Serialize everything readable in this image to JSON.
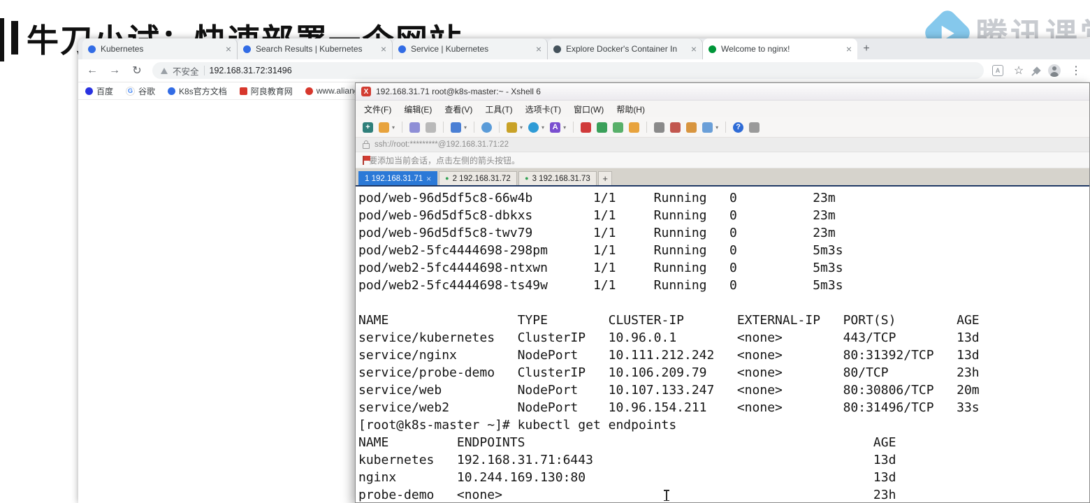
{
  "video": {
    "title": "牛刀小试：快速部署一个网站",
    "brand": "腾讯课堂"
  },
  "browser": {
    "tabs": [
      {
        "label": "Kubernetes"
      },
      {
        "label": "Search Results | Kubernetes"
      },
      {
        "label": "Service | Kubernetes"
      },
      {
        "label": "Explore Docker's Container In"
      },
      {
        "label": "Welcome to nginx!"
      }
    ],
    "address": {
      "security_label": "不安全",
      "url": "192.168.31.72:31496"
    },
    "bookmarks": [
      {
        "label": "百度"
      },
      {
        "label": "谷歌"
      },
      {
        "label": "K8s官方文档"
      },
      {
        "label": "阿良教育网"
      },
      {
        "label": "www.aliangedu..."
      }
    ]
  },
  "xshell": {
    "window_title": "192.168.31.71 root@k8s-master:~ - Xshell 6",
    "menu_items": [
      "文件(F)",
      "编辑(E)",
      "查看(V)",
      "工具(T)",
      "选项卡(T)",
      "窗口(W)",
      "帮助(H)"
    ],
    "ssh_bar": "ssh://root:*********@192.168.31.71:22",
    "hint_bar": "要添加当前会话，点击左侧的箭头按钮。",
    "session_tabs": [
      {
        "label": "1 192.168.31.71",
        "active": true
      },
      {
        "label": "2 192.168.31.72",
        "active": false
      },
      {
        "label": "3 192.168.31.73",
        "active": false
      }
    ],
    "terminal": {
      "lines": [
        "pod/web-96d5df5c8-66w4b        1/1     Running   0          23m",
        "pod/web-96d5df5c8-dbkxs        1/1     Running   0          23m",
        "pod/web-96d5df5c8-twv79        1/1     Running   0          23m",
        "pod/web2-5fc4444698-298pm      1/1     Running   0          5m3s",
        "pod/web2-5fc4444698-ntxwn      1/1     Running   0          5m3s",
        "pod/web2-5fc4444698-ts49w      1/1     Running   0          5m3s",
        "",
        "NAME                 TYPE        CLUSTER-IP       EXTERNAL-IP   PORT(S)        AGE",
        "service/kubernetes   ClusterIP   10.96.0.1        <none>        443/TCP        13d",
        "service/nginx        NodePort    10.111.212.242   <none>        80:31392/TCP   13d",
        "service/probe-demo   ClusterIP   10.106.209.79    <none>        80/TCP         23h",
        "service/web          NodePort    10.107.133.247   <none>        80:30806/TCP   20m",
        "service/web2         NodePort    10.96.154.211    <none>        80:31496/TCP   33s",
        "[root@k8s-master ~]# kubectl get endpoints",
        "NAME         ENDPOINTS                                              AGE",
        "kubernetes   192.168.31.71:6443                                     13d",
        "nginx        10.244.169.130:80                                      13d",
        "probe-demo   <none>                                                 23h"
      ]
    }
  },
  "glyphs": {
    "back": "←",
    "forward": "→",
    "reload": "↻",
    "star": "☆",
    "menu": "⋮",
    "plus": "+",
    "close": "×",
    "green_dot": "●",
    "caret": "▾",
    "letter_a": "A",
    "letter_g": "G",
    "letter_x": "X",
    "question": "?"
  },
  "colors": {
    "k8s_blue": "#326ce5",
    "nginx_green": "#009639",
    "xshell_active_tab": "#2b79d7",
    "terminal_stripe": "#203864"
  }
}
